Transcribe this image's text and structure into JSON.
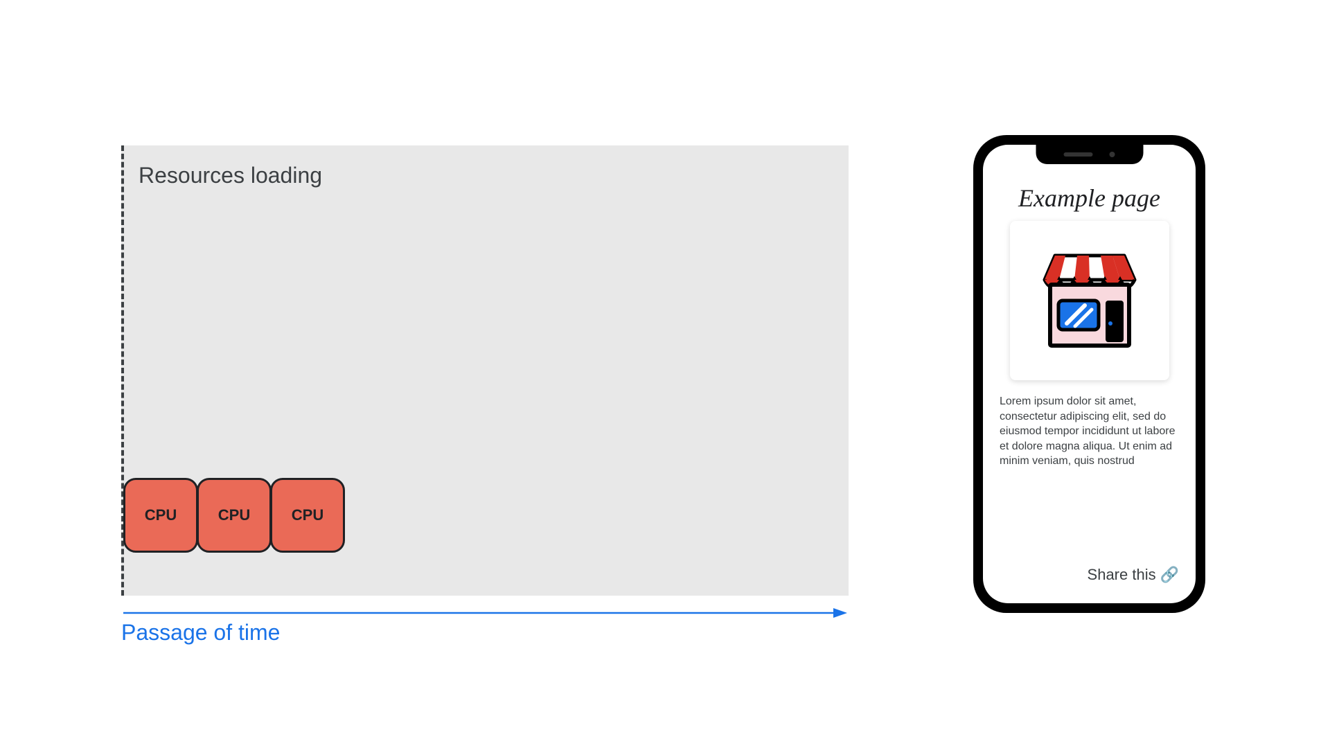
{
  "diagram": {
    "resources_label": "Resources loading",
    "cpu_block_label": "CPU",
    "cpu_block_count": 3,
    "time_label": "Passage of time",
    "colors": {
      "panel_bg": "#e8e8e8",
      "cpu_fill": "#ea6a57",
      "cpu_stroke": "#202124",
      "arrow": "#1a73e8",
      "axis_dash": "#3c4043"
    }
  },
  "phone": {
    "page_title": "Example page",
    "body_text": "Lorem ipsum dolor sit amet, consectetur adipiscing elit, sed do eiusmod tempor incididunt ut labore et dolore magna aliqua. Ut enim ad minim veniam, quis nostrud",
    "share_label": "Share this",
    "share_icon": "🔗"
  }
}
